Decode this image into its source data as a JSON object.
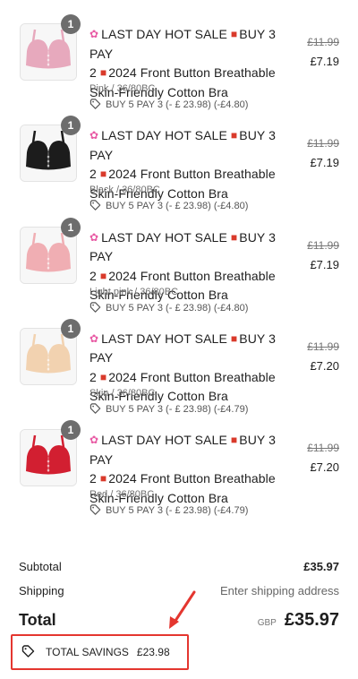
{
  "items": [
    {
      "title_line1": "LAST DAY HOT SALE",
      "title_line1b": "BUY 3 PAY",
      "title_line2": "2",
      "title_line2b": "2024 Front Button Breathable",
      "title_line3": "Skin-Friendly Cotton Bra",
      "variant": "Pink / 36/80BC",
      "discount": "BUY 5 PAY 3 (- £ 23.98) (-£4.80)",
      "price_original": "£11.99",
      "price_now": "£7.19",
      "qty": "1",
      "color": "#e7a9bd"
    },
    {
      "title_line1": "LAST DAY HOT SALE",
      "title_line1b": "BUY 3 PAY",
      "title_line2": "2",
      "title_line2b": "2024 Front Button Breathable",
      "title_line3": "Skin-Friendly Cotton Bra",
      "variant": "Black / 36/80BC",
      "discount": "BUY 5 PAY 3 (- £ 23.98) (-£4.80)",
      "price_original": "£11.99",
      "price_now": "£7.19",
      "qty": "1",
      "color": "#1c1c1c"
    },
    {
      "title_line1": "LAST DAY HOT SALE",
      "title_line1b": "BUY 3 PAY",
      "title_line2": "2",
      "title_line2b": "2024 Front Button Breathable",
      "title_line3": "Skin-Friendly Cotton Bra",
      "variant": "Light pink / 36/80BC",
      "discount": "BUY 5 PAY 3 (- £ 23.98) (-£4.80)",
      "price_original": "£11.99",
      "price_now": "£7.19",
      "qty": "1",
      "color": "#f0aeb3"
    },
    {
      "title_line1": "LAST DAY HOT SALE",
      "title_line1b": "BUY 3 PAY",
      "title_line2": "2",
      "title_line2b": "2024 Front Button Breathable",
      "title_line3": "Skin-Friendly Cotton Bra",
      "variant": "Skin / 36/80BC",
      "discount": "BUY 5 PAY 3 (- £ 23.98) (-£4.79)",
      "price_original": "£11.99",
      "price_now": "£7.20",
      "qty": "1",
      "color": "#f2d2b0"
    },
    {
      "title_line1": "LAST DAY HOT SALE",
      "title_line1b": "BUY 3 PAY",
      "title_line2": "2",
      "title_line2b": "2024 Front Button Breathable",
      "title_line3": "Skin-Friendly Cotton Bra",
      "variant": "Red / 36/80BC",
      "discount": "BUY 5 PAY 3 (- £ 23.98) (-£4.79)",
      "price_original": "£11.99",
      "price_now": "£7.20",
      "qty": "1",
      "color": "#d21f31"
    }
  ],
  "summary": {
    "subtotal_label": "Subtotal",
    "subtotal_value": "£35.97",
    "shipping_label": "Shipping",
    "shipping_value": "Enter shipping address",
    "total_label": "Total",
    "currency": "GBP",
    "total_value": "£35.97"
  },
  "savings": {
    "label": "TOTAL SAVINGS",
    "value": "£23.98"
  },
  "colors": {
    "highlight": "#e4362f",
    "badge": "#6d6d6d"
  }
}
